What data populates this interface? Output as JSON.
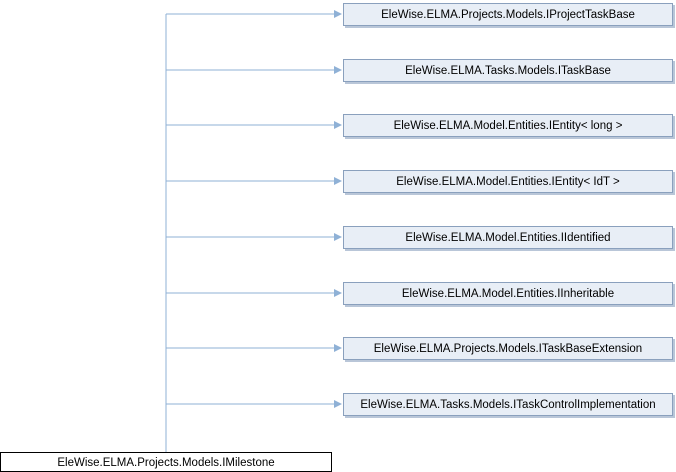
{
  "diagram": {
    "root": {
      "label": "EleWise.ELMA.Projects.Models.IMilestone"
    },
    "bases": [
      {
        "label": "EleWise.ELMA.Projects.Models.IProjectTaskBase"
      },
      {
        "label": "EleWise.ELMA.Tasks.Models.ITaskBase"
      },
      {
        "label": "EleWise.ELMA.Model.Entities.IEntity< long >"
      },
      {
        "label": "EleWise.ELMA.Model.Entities.IEntity< IdT >"
      },
      {
        "label": "EleWise.ELMA.Model.Entities.IIdentified"
      },
      {
        "label": "EleWise.ELMA.Model.Entities.IInheritable"
      },
      {
        "label": "EleWise.ELMA.Projects.Models.ITaskBaseExtension"
      },
      {
        "label": "EleWise.ELMA.Tasks.Models.ITaskControlImplementation"
      }
    ],
    "colors": {
      "edge": "#8fb1d6",
      "base_fill": "#e8eef6",
      "base_border": "#8aa0bd",
      "root_border": "#000000"
    }
  }
}
